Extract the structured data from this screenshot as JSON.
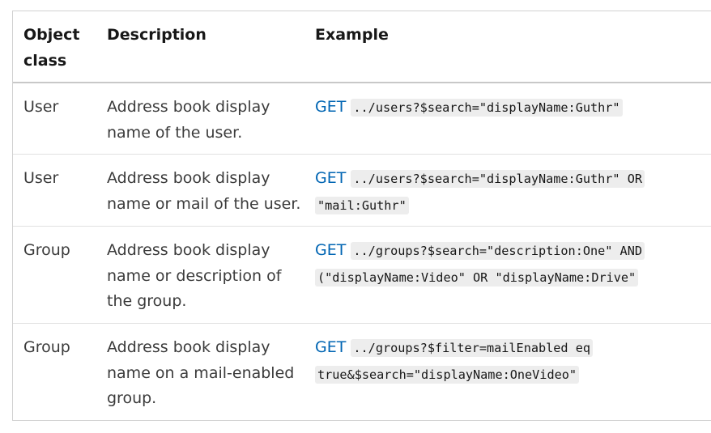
{
  "table": {
    "headers": {
      "object_class": "Object class",
      "description": "Description",
      "example": "Example"
    },
    "rows": [
      {
        "object_class": "User",
        "description": "Address book display name of the user.",
        "method": "GET",
        "code": "../users?$search=\"displayName:Guthr\""
      },
      {
        "object_class": "User",
        "description": "Address book display name or mail of the user.",
        "method": "GET",
        "code": "../users?$search=\"displayName:Guthr\" OR \"mail:Guthr\""
      },
      {
        "object_class": "Group",
        "description": "Address book display name or description of the group.",
        "method": "GET",
        "code": "../groups?$search=\"description:One\" AND (\"displayName:Video\" OR \"displayName:Drive\""
      },
      {
        "object_class": "Group",
        "description": "Address book display name on a mail-enabled group.",
        "method": "GET",
        "code": "../groups?$filter=mailEnabled eq true&$search=\"displayName:OneVideo\""
      }
    ]
  }
}
